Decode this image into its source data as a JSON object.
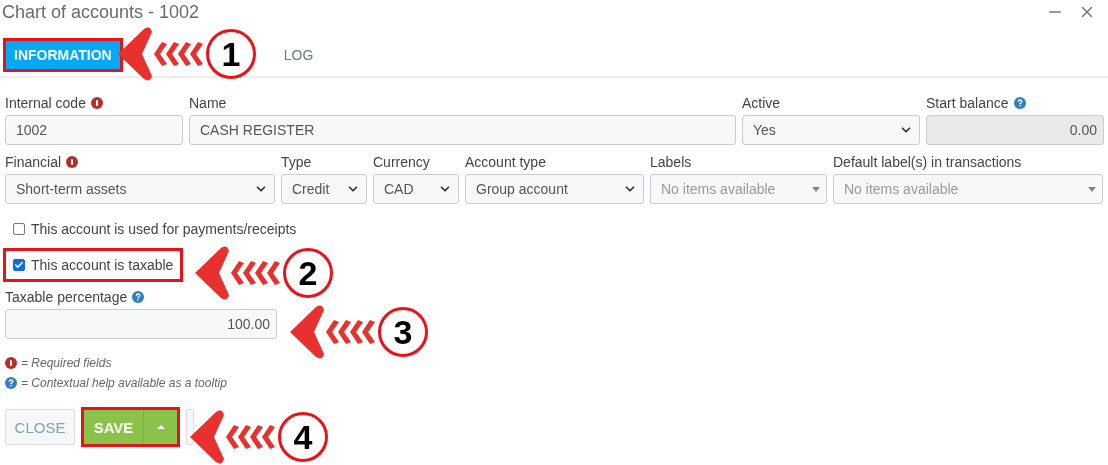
{
  "window": {
    "title": "Chart of accounts - 1002"
  },
  "tabs": [
    {
      "label": "INFORMATION",
      "selected": true,
      "highlighted": true
    },
    {
      "label": "LOG",
      "selected": false
    }
  ],
  "form_rows": [
    [
      {
        "kind": "text",
        "label": "Internal code",
        "required": true,
        "value": "1002"
      },
      {
        "kind": "text",
        "label": "Name",
        "value": "CASH REGISTER"
      },
      {
        "kind": "select",
        "label": "Active",
        "value": "Yes"
      },
      {
        "kind": "readonly",
        "label": "Start balance",
        "help": true,
        "value": "0.00"
      }
    ],
    [
      {
        "kind": "select",
        "label": "Financial",
        "required": true,
        "value": "Short-term assets"
      },
      {
        "kind": "select",
        "label": "Type",
        "value": "Credit"
      },
      {
        "kind": "select",
        "label": "Currency",
        "value": "CAD"
      },
      {
        "kind": "select",
        "label": "Account type",
        "value": "Group account"
      },
      {
        "kind": "multiselect",
        "label": "Labels",
        "placeholder": "No items available"
      },
      {
        "kind": "multiselect",
        "label": "Default label(s) in transactions",
        "placeholder": "No items available"
      }
    ]
  ],
  "checkboxes": [
    {
      "label": "This account is used for payments/receipts",
      "checked": false
    },
    {
      "label": "This account is taxable",
      "checked": true,
      "highlighted": true
    }
  ],
  "taxable_percentage": {
    "label": "Taxable percentage",
    "help": true,
    "value": "100.00"
  },
  "legend": [
    {
      "kind": "required",
      "text": "= Required fields"
    },
    {
      "kind": "help",
      "text": "= Contextual help available as a tooltip"
    }
  ],
  "buttons": {
    "close": "CLOSE",
    "save": "SAVE",
    "save_highlighted": true
  },
  "annotations": [
    {
      "number": "1"
    },
    {
      "number": "2"
    },
    {
      "number": "3"
    },
    {
      "number": "4"
    }
  ]
}
